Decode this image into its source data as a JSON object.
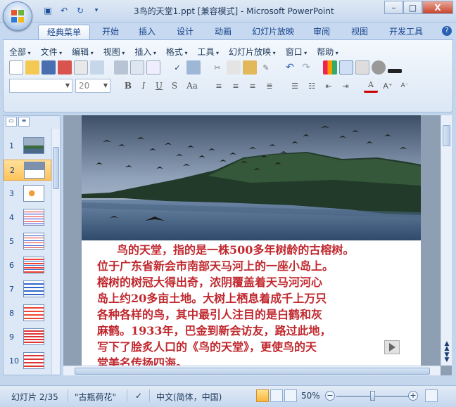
{
  "window": {
    "title": "3鸟的天堂1.ppt [兼容模式] - Microsoft PowerPoint",
    "controls": [
      "–",
      "□",
      "X"
    ]
  },
  "ribbon_tabs": [
    "经典菜单",
    "开始",
    "插入",
    "设计",
    "动画",
    "幻灯片放映",
    "审阅",
    "视图",
    "开发工具"
  ],
  "active_tab": "经典菜单",
  "menus": [
    "全部",
    "文件",
    "编辑",
    "视图",
    "插入",
    "格式",
    "工具",
    "幻灯片放映",
    "窗口",
    "帮助"
  ],
  "format": {
    "font_name": "",
    "font_size": "20",
    "bold": "B",
    "italic": "I",
    "underline": "U",
    "strike": "S",
    "case": "Aa"
  },
  "slides_pane": {
    "numbers": [
      "1",
      "2",
      "3",
      "4",
      "5",
      "6",
      "7",
      "8",
      "9",
      "10"
    ],
    "selected": "2"
  },
  "slide": {
    "lines": [
      "鸟的天堂，指的是一株500多年树龄的古榕树。",
      "位于广东省新会市南部天马河上的一座小岛上。",
      "榕树的树冠大得出奇，浓阴覆盖着天马河河心",
      "岛上约20多亩土地。大树上栖息着成千上万只",
      "各种各样的鸟，其中最引人注目的是白鹤和灰",
      "麻鹤。1933年，巴金到新会访友，路过此地，",
      "写下了脍炙人口的《鸟的天堂》，更使鸟的天",
      "堂美名传扬四海。"
    ]
  },
  "status": {
    "slide_info": "幻灯片 2/35",
    "theme": "\"古瓶荷花\"",
    "language": "中文(简体，中国)",
    "zoom": "50%",
    "zoom_minus": "−",
    "zoom_plus": "+"
  }
}
